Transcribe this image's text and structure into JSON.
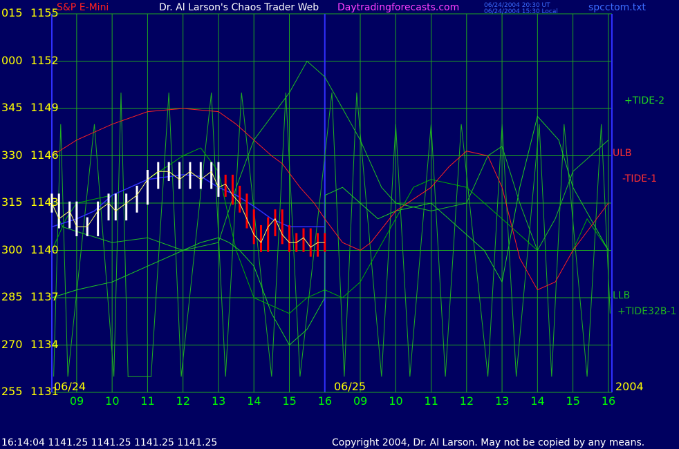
{
  "header": {
    "instrument": "S&P E-Mini",
    "title": "Dr. Al Larson's Chaos Trader Web",
    "site": "Daytradingforecasts.com",
    "time_ut": "06/24/2004 20:30 UT",
    "time_local": "06/24/2004 15:30 Local",
    "file": "spcctom.txt"
  },
  "footer": {
    "quote": "16:14:04  1141.25 1141.25 1141.25 1141.25",
    "copyright": "Copyright 2004, Dr. Al Larson. May not be copied by any means."
  },
  "colors": {
    "background": "#000060",
    "grid": "#1fa81f",
    "axis": "#3030ff",
    "price_up": "#ffffff",
    "price_down": "#ff0000",
    "ulb": "#ff2020",
    "llb": "#20c020",
    "tide2": "#20d020",
    "tide1": "#00b000",
    "tide32": "#20b020",
    "moving_avg": "#3030ff",
    "ylabels": "#ffff00",
    "xlabels": "#00ff00"
  },
  "chart_data": {
    "type": "line",
    "y_ticks": [
      {
        "angle": "015",
        "price": "1155"
      },
      {
        "angle": "000",
        "price": "1152"
      },
      {
        "angle": "345",
        "price": "1149"
      },
      {
        "angle": "330",
        "price": "1146"
      },
      {
        "angle": "315",
        "price": "1143"
      },
      {
        "angle": "300",
        "price": "1140"
      },
      {
        "angle": "285",
        "price": "1137"
      },
      {
        "angle": "270",
        "price": "1134"
      },
      {
        "angle": "255",
        "price": "1131"
      }
    ],
    "ylim": [
      1131,
      1155
    ],
    "x_ticks_day1": [
      "09",
      "10",
      "11",
      "12",
      "13",
      "14",
      "15",
      "16"
    ],
    "x_ticks_day2": [
      "09",
      "10",
      "11",
      "12",
      "13",
      "14",
      "15",
      "16"
    ],
    "date_labels": {
      "day1": "06/24",
      "day2": "06/25",
      "year": "2004"
    },
    "series_labels": {
      "tide2": "+TIDE-2",
      "ulb": "ULB",
      "tide1": "-TIDE-1",
      "llb": "LLB",
      "tide32": "+TIDE32B-1"
    },
    "series": [
      {
        "name": "ULB",
        "x": [
          8.3,
          9,
          10,
          11,
          12,
          13,
          13.5,
          14,
          14.5,
          14.8,
          15.3,
          15.7,
          16,
          16.5,
          17,
          17.3,
          18,
          19,
          19.5,
          20,
          20.6,
          21,
          21.5,
          22,
          22.5,
          23,
          24
        ],
        "values": [
          1146,
          1147,
          1148,
          1148.8,
          1149,
          1148.8,
          1148,
          1147,
          1146,
          1145.5,
          1144,
          1143,
          1142,
          1140.5,
          1140,
          1140.5,
          1142.5,
          1144,
          1145.3,
          1146.3,
          1146,
          1144,
          1139.5,
          1137.5,
          1138,
          1140,
          1143
        ]
      },
      {
        "name": "LLB",
        "x": [
          8.3,
          8.6,
          9,
          10,
          11,
          12,
          13,
          13.5,
          14,
          14.5,
          15,
          15.5,
          16,
          16.5,
          17,
          17.6,
          18,
          19,
          20,
          20.6,
          21,
          21.5,
          22,
          22.5,
          23,
          24
        ],
        "values": [
          1143,
          1141.5,
          1141.2,
          1140.5,
          1140.8,
          1140,
          1140.5,
          1144,
          1147,
          1148.5,
          1150,
          1152,
          1151,
          1149,
          1147,
          1144,
          1143,
          1142.5,
          1143,
          1146,
          1146.6,
          1143,
          1140,
          1142,
          1145,
          1147
        ]
      },
      {
        "name": "+TIDE-2",
        "x": [
          8.3,
          9,
          10,
          11,
          11.5,
          12,
          12.5,
          13,
          13.3,
          13.6,
          14,
          14.5,
          15,
          15.5,
          16,
          16.01,
          16.5,
          17,
          17.5,
          18,
          19,
          20,
          20.5,
          21,
          21.5,
          22,
          22.6,
          23,
          23.5,
          24
        ],
        "values": [
          1137,
          1137.5,
          1138,
          1139,
          1139.5,
          1140,
          1140.5,
          1140.8,
          1140.5,
          1140,
          1139,
          1136,
          1134,
          1135,
          1137,
          1143.5,
          1144,
          1143,
          1142,
          1142.5,
          1143,
          1141,
          1140,
          1138,
          1144,
          1148.5,
          1147,
          1144,
          1142,
          1140
        ]
      },
      {
        "name": "-TIDE-1",
        "x": [
          8.3,
          8.7,
          9,
          10,
          11,
          12,
          12.5,
          13,
          13.5,
          14,
          14.5,
          15,
          15.5,
          16,
          16.5,
          17,
          17.5,
          18,
          18.5,
          19,
          20,
          21,
          22,
          23,
          23.4,
          24
        ],
        "values": [
          1140,
          1142,
          1143,
          1143.5,
          1144.5,
          1146,
          1146.5,
          1145,
          1140,
          1137,
          1136.5,
          1136,
          1137,
          1137.5,
          1137,
          1138,
          1140,
          1142,
          1144,
          1144.5,
          1144,
          1142,
          1140,
          1140,
          1142,
          1140
        ]
      },
      {
        "name": "+TIDE32B-1",
        "x": [
          8.35,
          8.55,
          8.75,
          9.5,
          10.05,
          10.25,
          10.45,
          11.1,
          11.6,
          11.95,
          12.8,
          13.2,
          13.65,
          14.5,
          14.9,
          15.3,
          16.2,
          16.55,
          16.9,
          17.6,
          18,
          18.4,
          19,
          19.4,
          19.85,
          20.6,
          21,
          21.4,
          22.05,
          22.4,
          22.75,
          23.4,
          23.8,
          24.05
        ],
        "values": [
          1132,
          1148,
          1132,
          1148,
          1132,
          1150,
          1132,
          1132,
          1150,
          1132,
          1150,
          1132,
          1150,
          1132,
          1150,
          1132,
          1150,
          1132,
          1150,
          1132,
          1148,
          1132,
          1148,
          1132,
          1148,
          1132,
          1148,
          1132,
          1148,
          1132,
          1148,
          1132,
          1148,
          1136
        ]
      },
      {
        "name": "moving-average",
        "x": [
          8.3,
          9,
          9.5,
          10,
          11,
          12,
          12.5,
          13,
          13.5,
          14,
          14.5,
          15,
          15.5,
          16
        ],
        "values": [
          1141.5,
          1142,
          1142.5,
          1143.5,
          1144.5,
          1144.8,
          1144.7,
          1144,
          1143.5,
          1142.8,
          1142,
          1141.5,
          1141.5,
          1141.5
        ]
      },
      {
        "name": "price",
        "x": [
          8.3,
          8.5,
          8.8,
          9,
          9.3,
          9.6,
          9.9,
          10.1,
          10.4,
          10.7,
          11,
          11.3,
          11.6,
          11.9,
          12.2,
          12.5,
          12.8,
          13,
          13.2,
          13.4,
          13.6,
          13.8,
          14,
          14.2,
          14.4,
          14.6,
          14.8,
          15,
          15.2,
          15.4,
          15.6,
          15.8,
          16
        ],
        "values": [
          1143,
          1142,
          1142.5,
          1141.5,
          1141.5,
          1142.5,
          1143,
          1142.5,
          1143,
          1143.5,
          1144.5,
          1145,
          1145,
          1144.5,
          1145,
          1144.5,
          1145,
          1144,
          1144.2,
          1143.5,
          1143,
          1142,
          1141,
          1140.5,
          1141.5,
          1142,
          1141,
          1140.5,
          1140.5,
          1140.8,
          1140.2,
          1140.5,
          1140.5
        ]
      }
    ],
    "grid": true
  }
}
